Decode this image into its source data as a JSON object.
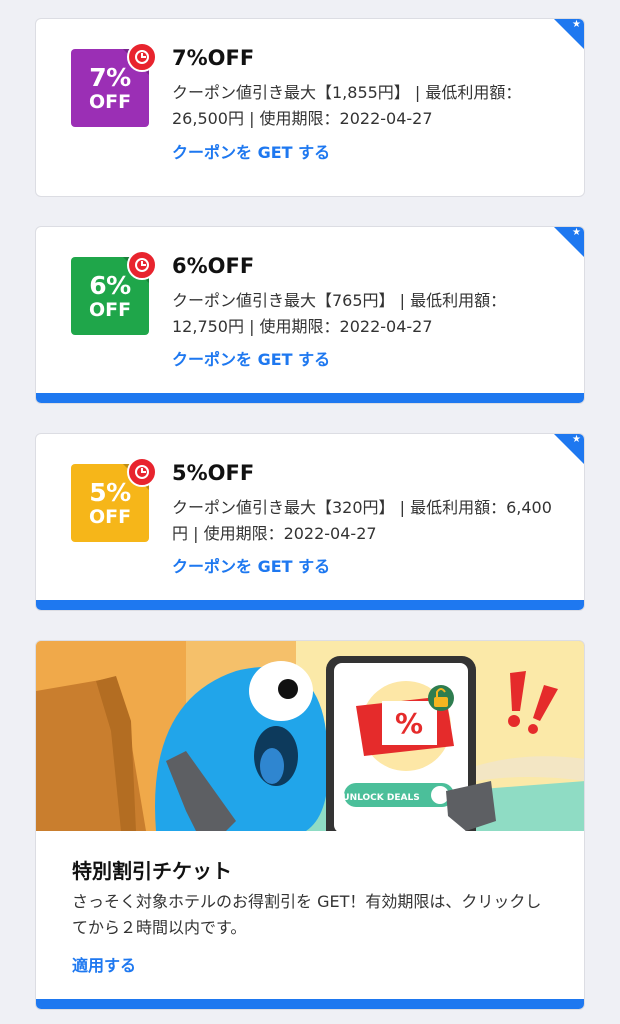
{
  "coupons": [
    {
      "badge_percent": "7%",
      "badge_off": "OFF",
      "badge_color": "#9b2fb5",
      "title": "7%OFF",
      "description": "クーポン値引き最大【1,855円】 | 最低利用額：26,500円 | 使用期限：2022-04-27",
      "link": "クーポンを GET する"
    },
    {
      "badge_percent": "6%",
      "badge_off": "OFF",
      "badge_color": "#1fa64a",
      "title": "6%OFF",
      "description": "クーポン値引き最大【765円】 | 最低利用額：12,750円 | 使用期限：2022-04-27",
      "link": "クーポンを GET する"
    },
    {
      "badge_percent": "5%",
      "badge_off": "OFF",
      "badge_color": "#f6b619",
      "title": "5%OFF",
      "description": "クーポン値引き最大【320円】 | 最低利用額：6,400円 | 使用期限：2022-04-27",
      "link": "クーポンを GET する"
    }
  ],
  "special": {
    "banner_button": "UNLOCK DEALS",
    "banner_symbol": "%",
    "title": "特別割引チケット",
    "description": "さっそく対象ホテルのお得割引を GET！有効期限は、クリックしてから２時間以内です。",
    "link": "適用する"
  },
  "colors": {
    "accent": "#1e78f0",
    "background": "#eff0f5",
    "timer": "#e8242e"
  },
  "icons": [
    "star-icon",
    "timer-icon",
    "padlock-icon",
    "exclamation-icon"
  ]
}
